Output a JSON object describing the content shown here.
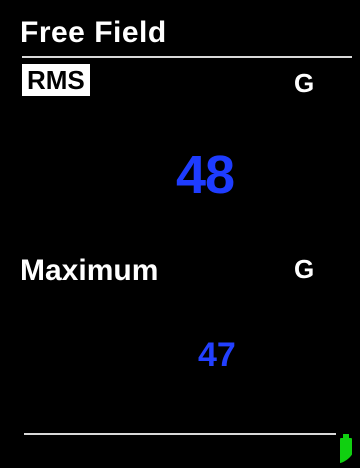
{
  "header": {
    "title": "Free Field"
  },
  "rms": {
    "label": "RMS",
    "unit": "G",
    "value": "48",
    "value_color": "#1e3cff"
  },
  "maximum": {
    "label": "Maximum",
    "unit": "G",
    "value": "47",
    "value_color": "#2340ff"
  },
  "status": {
    "battery_icon": "battery-icon",
    "battery_color": "#10d010"
  }
}
